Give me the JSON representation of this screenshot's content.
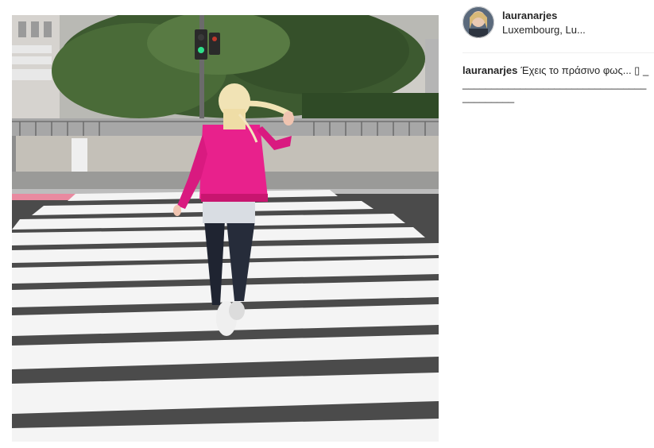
{
  "post": {
    "username": "lauranarjes",
    "location": "Luxembourg, Lu...",
    "caption_user": "lauranarjes",
    "caption_text": "Έχεις το πράσινο φως... ",
    "caption_emoji": "▯",
    "caption_underline": "__________________________________________"
  },
  "image": {
    "description_icon": "photo-of-person-crossing-street",
    "jacket_color": "#e8218c",
    "stripe_color": "#f4f4f4",
    "road_color": "#4b4b4b"
  },
  "colors": {
    "text": "#262626",
    "divider": "#efefef"
  }
}
